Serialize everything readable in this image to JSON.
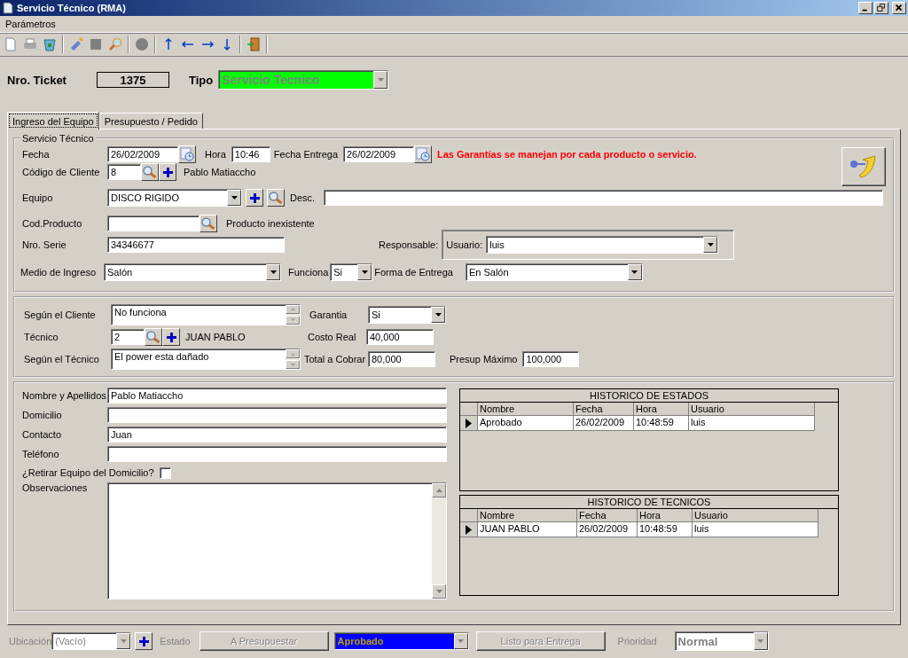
{
  "window": {
    "title": "Servicio Técnico (RMA)"
  },
  "menu": [
    "Parámetros"
  ],
  "header": {
    "ticket_label": "Nro. Ticket",
    "ticket": "1375",
    "tipo_label": "Tipo",
    "tipo": "Servicio Tecnico"
  },
  "tabs": [
    {
      "label": "Ingreso del Equipo",
      "selected": true
    },
    {
      "label": "Presupuesto / Pedido",
      "selected": false
    }
  ],
  "servicio": {
    "legend": "Servicio Técnico",
    "fecha_label": "Fecha",
    "fecha": "26/02/2009",
    "hora_label": "Hora",
    "hora": "10:46",
    "entrega_label": "Fecha Entrega",
    "entrega": "26/02/2009",
    "warning": "Las Garantías se manejan por cada producto o servicio.",
    "cliente_label": "Código de Cliente",
    "cliente": "8",
    "cliente_nombre": "Pablo Matiaccho",
    "equipo_label": "Equipo",
    "equipo": "DISCO RIGIDO",
    "desc_label": "Desc.",
    "producto_label": "Cod.Producto",
    "producto_estado": "Producto inexistente",
    "serie_label": "Nro. Serie",
    "serie": "34346677",
    "responsable_label": "Responsable:",
    "usuario_label": "Usuario:",
    "usuario": "luis",
    "medio_label": "Medio de Ingreso",
    "medio": "Salón",
    "funciona_label": "Funciona",
    "funciona": "Si",
    "forma_label": "Forma de Entrega",
    "forma": "En Salón"
  },
  "diagnostico": {
    "cliente_label": "Según el Cliente",
    "cliente": "No funciona",
    "tecnico_label": "Técnico",
    "tecnico": "2",
    "tecnico_nombre": "JUAN PABLO",
    "segun_tecnico_label": "Según el Técnico",
    "segun_tecnico": "El power esta dañado",
    "garantia_label": "Garantia",
    "garantia": "Si",
    "costo_label": "Costo Real",
    "costo": "40,000",
    "total_label": "Total a Cobrar",
    "total": "80,000",
    "presup_label": "Presup Máximo",
    "presup": "100,000"
  },
  "contacto": {
    "nombre_label": "Nombre y Apellidos",
    "nombre": "Pablo Matiaccho",
    "domicilio_label": "Domicilio",
    "contacto_label": "Contacto",
    "contacto": "Juan",
    "telefono_label": "Teléfono",
    "retirar_label": "¿Retirar Equipo del Domicilio?",
    "retirar_checked": false,
    "observaciones_label": "Observaciones"
  },
  "historicos": [
    {
      "title": "HISTORICO DE ESTADOS",
      "columns": [
        "Nombre",
        "Fecha",
        "Hora",
        "Usuario"
      ],
      "rows": [
        {
          "cells": [
            "Aprobado",
            "26/02/2009",
            "10:48:59",
            "luis"
          ],
          "current": true
        }
      ]
    },
    {
      "title": "HISTORICO DE TECNICOS",
      "columns": [
        "Nombre",
        "Fecha",
        "Hora",
        "Usuario"
      ],
      "rows": [
        {
          "cells": [
            "JUAN PABLO",
            "26/02/2009",
            "10:48:59",
            "luis"
          ],
          "current": true
        }
      ]
    }
  ],
  "bottom": {
    "disabled": true,
    "ubicacion_label": "Ubicación",
    "ubicacion": "(Vacío)",
    "estado_label": "Estado",
    "presupuestar": "A Presupuestar",
    "estado": "Aprobado",
    "entrega": "Listo para Entrega",
    "prioridad_label": "Prioridad",
    "prioridad": "Normal"
  }
}
